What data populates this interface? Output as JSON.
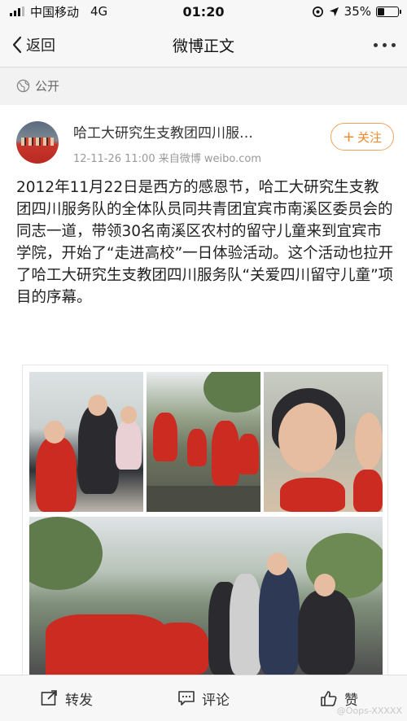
{
  "status_bar": {
    "carrier": "中国移动",
    "network": "4G",
    "time": "01:20",
    "battery": "35%",
    "battery_level": 0.35
  },
  "nav": {
    "back_label": "返回",
    "title": "微博正文"
  },
  "visibility": {
    "label": "公开"
  },
  "post": {
    "author": "哈工大研究生支教团四川服…",
    "meta": "12-11-26 11:00  来自微博 weibo.com",
    "follow_label": "关注",
    "text": "2012年11月22日是西方的感恩节，哈工大研究生支教团四川服务队的全体队员同共青团宜宾市南溪区委员会的同志一道，带领30名南溪区农村的留守儿童来到宜宾市学院，开始了“走进高校”一日体验活动。这个活动也拉开了哈工大研究生支教团四川服务队“关爱四川留守儿童”项目的序幕。"
  },
  "actions": {
    "repost": "转发",
    "comment": "评论",
    "like": "赞"
  },
  "watermark": "@Oops-XXXXX",
  "colors": {
    "accent": "#f08a2c",
    "background": "#f2f2f2"
  },
  "icons": [
    "signal-icon",
    "gps-icon",
    "location-arrow-icon",
    "battery-icon",
    "back-chevron-icon",
    "more-icon",
    "globe-icon",
    "plus-icon",
    "repost-icon",
    "comment-icon",
    "like-icon"
  ]
}
